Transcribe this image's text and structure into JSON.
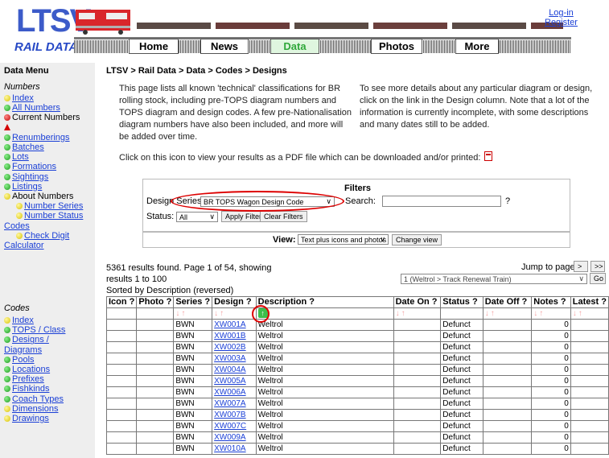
{
  "header": {
    "logo_text": "LTSV",
    "site_name": "RAIL DATA",
    "nav": [
      "Home",
      "News",
      "Data",
      "Photos",
      "More"
    ],
    "login": "Log-in",
    "register": "Register"
  },
  "sidebar": {
    "title": "Data Menu",
    "numbers_heading": "Numbers",
    "numbers_items": [
      {
        "label": "Index",
        "icon": "yellow-dot",
        "link": true
      },
      {
        "label": "All Numbers",
        "icon": "green-dot",
        "link": true
      },
      {
        "label": "Current Numbers",
        "icon": "red-dot",
        "link": false
      },
      {
        "label": "",
        "icon": "warning-icon",
        "link": false
      },
      {
        "label": "Renumberings",
        "icon": "green-dot",
        "link": true
      },
      {
        "label": "Batches",
        "icon": "green-dot",
        "link": true
      },
      {
        "label": "Lots",
        "icon": "green-dot",
        "link": true
      },
      {
        "label": "Formations",
        "icon": "green-dot",
        "link": true
      },
      {
        "label": "Sightings",
        "icon": "green-dot",
        "link": true
      },
      {
        "label": "Listings",
        "icon": "green-dot",
        "link": true
      },
      {
        "label": "About Numbers",
        "icon": "yellow-dot",
        "link": false
      },
      {
        "label": "Number Series",
        "icon": "yellow-dot",
        "link": true,
        "indent": true
      },
      {
        "label": "Number Status",
        "icon": "yellow-dot",
        "link": true,
        "indent": true
      },
      {
        "label": "Codes",
        "icon": "",
        "link": true
      },
      {
        "label": "Check Digit",
        "icon": "yellow-dot",
        "link": true,
        "indent": true
      },
      {
        "label": "Calculator",
        "icon": "",
        "link": true
      }
    ],
    "codes_heading": "Codes",
    "codes_items": [
      {
        "label": "Index",
        "icon": "yellow-dot"
      },
      {
        "label": "TOPS / Class",
        "icon": "green-dot"
      },
      {
        "label": "Designs /",
        "icon": "green-dot"
      },
      {
        "label": "Diagrams",
        "icon": ""
      },
      {
        "label": "Pools",
        "icon": "green-dot"
      },
      {
        "label": "Locations",
        "icon": "green-dot"
      },
      {
        "label": "Prefixes",
        "icon": "green-dot"
      },
      {
        "label": "Fishkinds",
        "icon": "green-dot"
      },
      {
        "label": "Coach Types",
        "icon": "green-dot"
      },
      {
        "label": "Dimensions",
        "icon": "yellow-dot"
      },
      {
        "label": "Drawings",
        "icon": "yellow-dot"
      }
    ]
  },
  "main": {
    "breadcrumb": "LTSV > Rail Data > Data > Codes > Designs",
    "intro_left": "This page lists all known 'technical' classifications for BR rolling stock, including pre-TOPS diagram numbers and TOPS diagram and design codes. A few pre-Nationalisation diagram numbers have also been included, and more will be added over time.",
    "intro_right": "To see more details about any particular diagram or design, click on the link in the Design column. Note that a lot of the information is currently incomplete, with some descriptions and many dates still to be added.",
    "pdf_line": "Click on this icon to view your results as a PDF file which can be downloaded and/or printed:",
    "filters": {
      "title": "Filters",
      "design_series_label": "Design Series:",
      "design_series_value": "BR TOPS Wagon Design Code",
      "search_label": "Search:",
      "search_value": "",
      "help": "?",
      "status_label": "Status:",
      "status_value": "All",
      "apply": "Apply Filters",
      "clear": "Clear Filters",
      "view_label": "View:",
      "view_value": "Text plus icons and photos",
      "change_view": "Change view"
    },
    "results_text": "5361 results found. Page 1 of 54, showing results 1 to 100",
    "jump_label": "Jump to page:",
    "jump_next": ">",
    "jump_last": ">>",
    "jump_select": "1 (Weltrol > Track Renewal Train)",
    "go": "Go",
    "sorted": "Sorted by Description (reversed)",
    "columns": [
      "Icon ?",
      "Photo ?",
      "Series ?",
      "Design ?",
      "Description ?",
      "Date On ?",
      "Status ?",
      "Date Off ?",
      "Notes ?",
      "Latest ?"
    ],
    "sort_arrows": "↓↑",
    "active_sort_arrow": "↑",
    "rows": [
      {
        "series": "BWN",
        "design": "XW001A",
        "description": "Weltrol",
        "status": "Defunct",
        "notes": "0"
      },
      {
        "series": "BWN",
        "design": "XW001B",
        "description": "Weltrol",
        "status": "Defunct",
        "notes": "0"
      },
      {
        "series": "BWN",
        "design": "XW002B",
        "description": "Weltrol",
        "status": "Defunct",
        "notes": "0"
      },
      {
        "series": "BWN",
        "design": "XW003A",
        "description": "Weltrol",
        "status": "Defunct",
        "notes": "0"
      },
      {
        "series": "BWN",
        "design": "XW004A",
        "description": "Weltrol",
        "status": "Defunct",
        "notes": "0"
      },
      {
        "series": "BWN",
        "design": "XW005A",
        "description": "Weltrol",
        "status": "Defunct",
        "notes": "0"
      },
      {
        "series": "BWN",
        "design": "XW006A",
        "description": "Weltrol",
        "status": "Defunct",
        "notes": "0"
      },
      {
        "series": "BWN",
        "design": "XW007A",
        "description": "Weltrol",
        "status": "Defunct",
        "notes": "0"
      },
      {
        "series": "BWN",
        "design": "XW007B",
        "description": "Weltrol",
        "status": "Defunct",
        "notes": "0"
      },
      {
        "series": "BWN",
        "design": "XW007C",
        "description": "Weltrol",
        "status": "Defunct",
        "notes": "0"
      },
      {
        "series": "BWN",
        "design": "XW009A",
        "description": "Weltrol",
        "status": "Defunct",
        "notes": "0"
      },
      {
        "series": "BWN",
        "design": "XW010A",
        "description": "Weltrol",
        "status": "Defunct",
        "notes": "0"
      }
    ]
  }
}
